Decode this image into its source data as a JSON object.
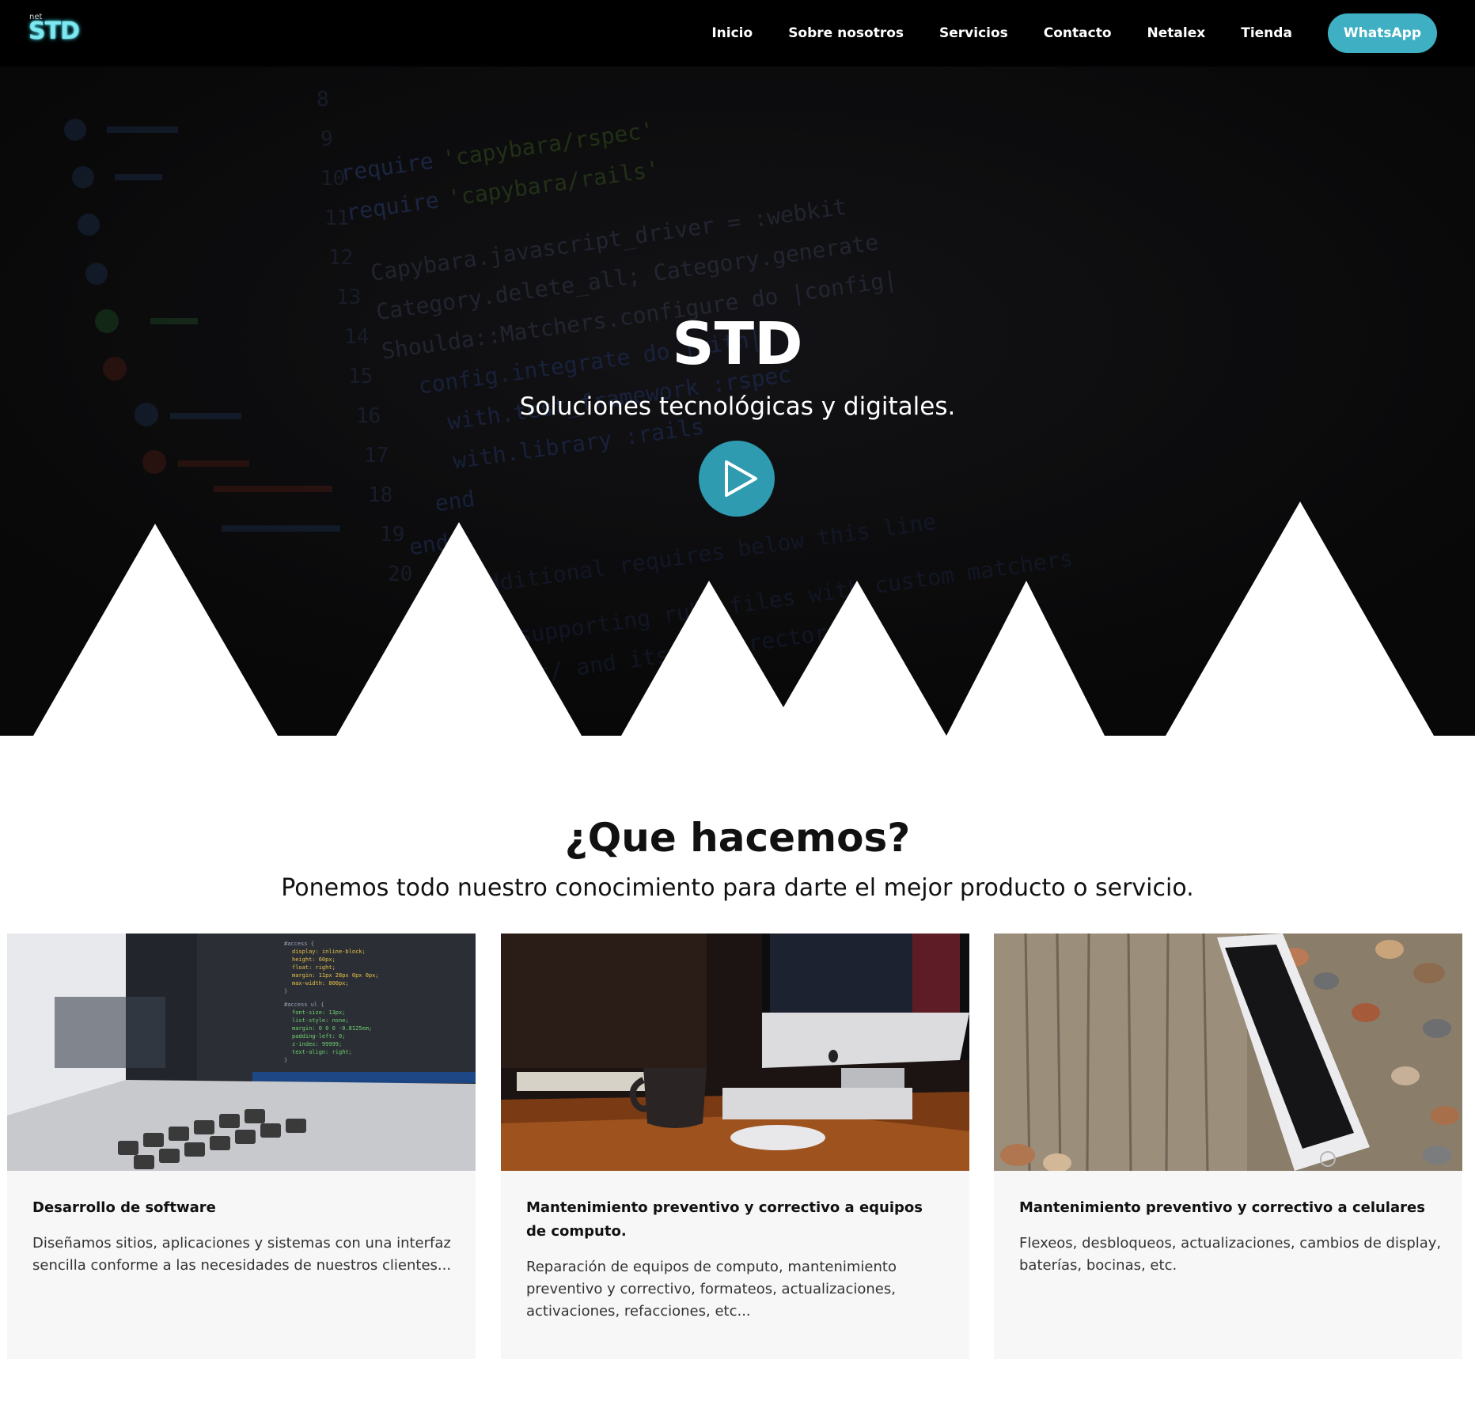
{
  "nav": {
    "logo_small": "net",
    "logo_main": "STD",
    "links": [
      "Inicio",
      "Sobre nosotros",
      "Servicios",
      "Contacto",
      "Netalex",
      "Tienda"
    ],
    "cta": "WhatsApp"
  },
  "hero": {
    "title": "STD",
    "subtitle": "Soluciones tecnológicas y digitales.",
    "play_icon": "play-icon"
  },
  "section": {
    "title": "¿Que hacemos?",
    "subtitle": "Ponemos todo nuestro conocimiento para darte el mejor producto o servicio."
  },
  "cards": [
    {
      "title": "Desarrollo de software",
      "text": "Diseñamos sitios, aplicaciones y sistemas con una interfaz sencilla conforme a las necesidades de nuestros clientes..."
    },
    {
      "title": "Mantenimiento preventivo y correctivo a equipos de computo.",
      "text": "Reparación de equipos de computo, mantenimiento preventivo y correctivo, formateos, actualizaciones, activaciones, refacciones, etc..."
    },
    {
      "title": "Mantenimiento preventivo y correctivo a celulares",
      "text": "Flexeos, desbloqueos, actualizaciones, cambios de display, baterías, bocinas, etc."
    }
  ],
  "colors": {
    "accent": "#3fb0c3",
    "play": "#2e9bb0",
    "nav_bg": "#000000",
    "hero_bg": "#0e0e0e",
    "card_bg": "#f7f7f7"
  }
}
